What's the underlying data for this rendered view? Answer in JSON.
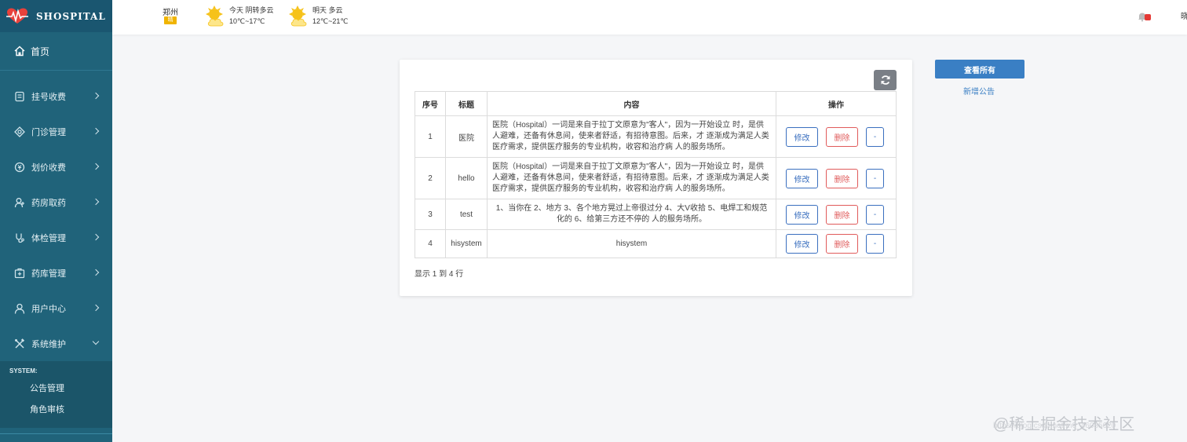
{
  "app": {
    "logo_text": "SHOSPITAL"
  },
  "header": {
    "city": "郑州",
    "city_badge": "晴",
    "weather": [
      {
        "line1": "今天 阴转多云",
        "line2": "10℃~17℃",
        "icon": "partly-cloudy-icon"
      },
      {
        "line1": "明天 多云",
        "line2": "12℃~21℃",
        "icon": "partly-cloudy-icon"
      }
    ],
    "right_text": "晓"
  },
  "sidebar": {
    "home": "首页",
    "items": [
      {
        "label": "挂号收费",
        "icon": "register-icon"
      },
      {
        "label": "门诊管理",
        "icon": "outpatient-icon"
      },
      {
        "label": "划价收费",
        "icon": "pricing-icon"
      },
      {
        "label": "药房取药",
        "icon": "pharmacy-icon"
      },
      {
        "label": "体检管理",
        "icon": "checkup-icon"
      },
      {
        "label": "药库管理",
        "icon": "warehouse-icon"
      },
      {
        "label": "用户中心",
        "icon": "user-icon"
      },
      {
        "label": "系统维护",
        "icon": "tools-icon"
      }
    ],
    "submenu_title": "SYSTEM:",
    "submenu": [
      "公告管理",
      "角色审核"
    ]
  },
  "table": {
    "headers": [
      "序号",
      "标题",
      "内容",
      "操作"
    ],
    "rows": [
      {
        "no": "1",
        "title": "医院",
        "content": "医院（Hospital）一词是来自于拉丁文原意为\"客人\"，因为一开始设立 时，是供人避难，还备有休息间，使来者舒适，有招待意图。后来，才 逐渐成为满足人类医疗需求，提供医疗服务的专业机构，收容和治疗病 人的服务场所。"
      },
      {
        "no": "2",
        "title": "hello",
        "content": "医院（Hospital）一词是来自于拉丁文原意为\"客人\"，因为一开始设立 时，是供人避难，还备有休息间，使来者舒适，有招待意图。后来，才 逐渐成为满足人类医疗需求，提供医疗服务的专业机构，收容和治疗病 人的服务场所。"
      },
      {
        "no": "3",
        "title": "test",
        "content": "1、当你在 2、地方 3、各个地方晃过上帝很过分 4、大V收拾 5、电焊工和规范化的 6、给第三方还不停的 人的服务场所。"
      },
      {
        "no": "4",
        "title": "hisystem",
        "content": "hisystem"
      }
    ],
    "edit_label": "修改",
    "delete_label": "删除",
    "dash_label": "-",
    "footer": "显示 1 到 4 行"
  },
  "actions": {
    "view_all": "查看所有",
    "add_notice": "新增公告"
  },
  "watermark": {
    "text": "@稀土掘金技术社区",
    "url": "https://blog.csdn.net/m0_46085620"
  }
}
